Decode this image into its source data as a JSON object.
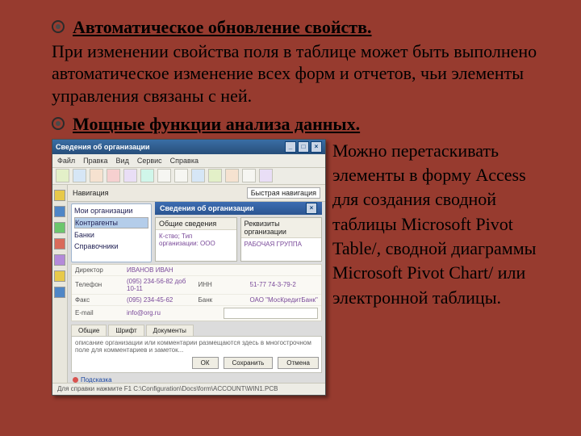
{
  "bullets": {
    "h1": "Автоматическое обновление свойств.",
    "p1": "При изменении свойства поля в таблице может быть выполнено автоматическое изменение всех форм и отчетов, чьи элементы управления связаны с ней.",
    "h2": "Мощные функции анализа данных.",
    "right": "Можно перетаскивать элементы в форму Access  для создания сводной таблицы Microsoft Pivot Table/, сводной диаграммы Microsoft Pivot Chart/ или электронной таблицы."
  },
  "shot": {
    "title": "Сведения об организации",
    "menu": [
      "Файл",
      "Правка",
      "Вид",
      "Сервис",
      "Справка"
    ],
    "panel": {
      "label": "Навигация",
      "select": "Быстрая навигация"
    },
    "nav": {
      "items": [
        "Мои организации",
        "Контрагенты",
        "Банки",
        "Справочники"
      ],
      "selected": 1
    },
    "subheader": "Сведения об организации",
    "cards": {
      "left_head": "Общие сведения",
      "left_body": "К-ство; Тип организации: ООО",
      "right_head": "Реквизиты организации",
      "right_body": "РАБОЧАЯ ГРУППА"
    },
    "form": {
      "r1_label": "Директор",
      "r1_val": "ИВАНОВ ИВАН",
      "r2_label": "Телефон",
      "r2_val": "(095) 234-56-82  доб 10-11",
      "r3_label": "Факс",
      "r3_val": "(095) 234-45-62",
      "r4_label": "E-mail",
      "r4_val": "info@org.ru",
      "r5a_label": "ИНН",
      "r5a_val": "51-77 74-3-79-2",
      "r5b_label": "Банк",
      "r5b_val": "ОАО \"МосКредитБанк\""
    },
    "tabs": [
      "Общие",
      "Шрифт",
      "Документы"
    ],
    "textarea": "описание организации или комментарии размещаются здесь в многострочном поле для комментариев и заметок...",
    "link": "Подсказка",
    "buttons": {
      "ok": "ОК",
      "save": "Сохранить",
      "cancel": "Отмена"
    },
    "status": "Для справки нажмите F1   C:\\Configuration\\Docs\\form\\ACCOUNT\\WIN1.PCB"
  }
}
